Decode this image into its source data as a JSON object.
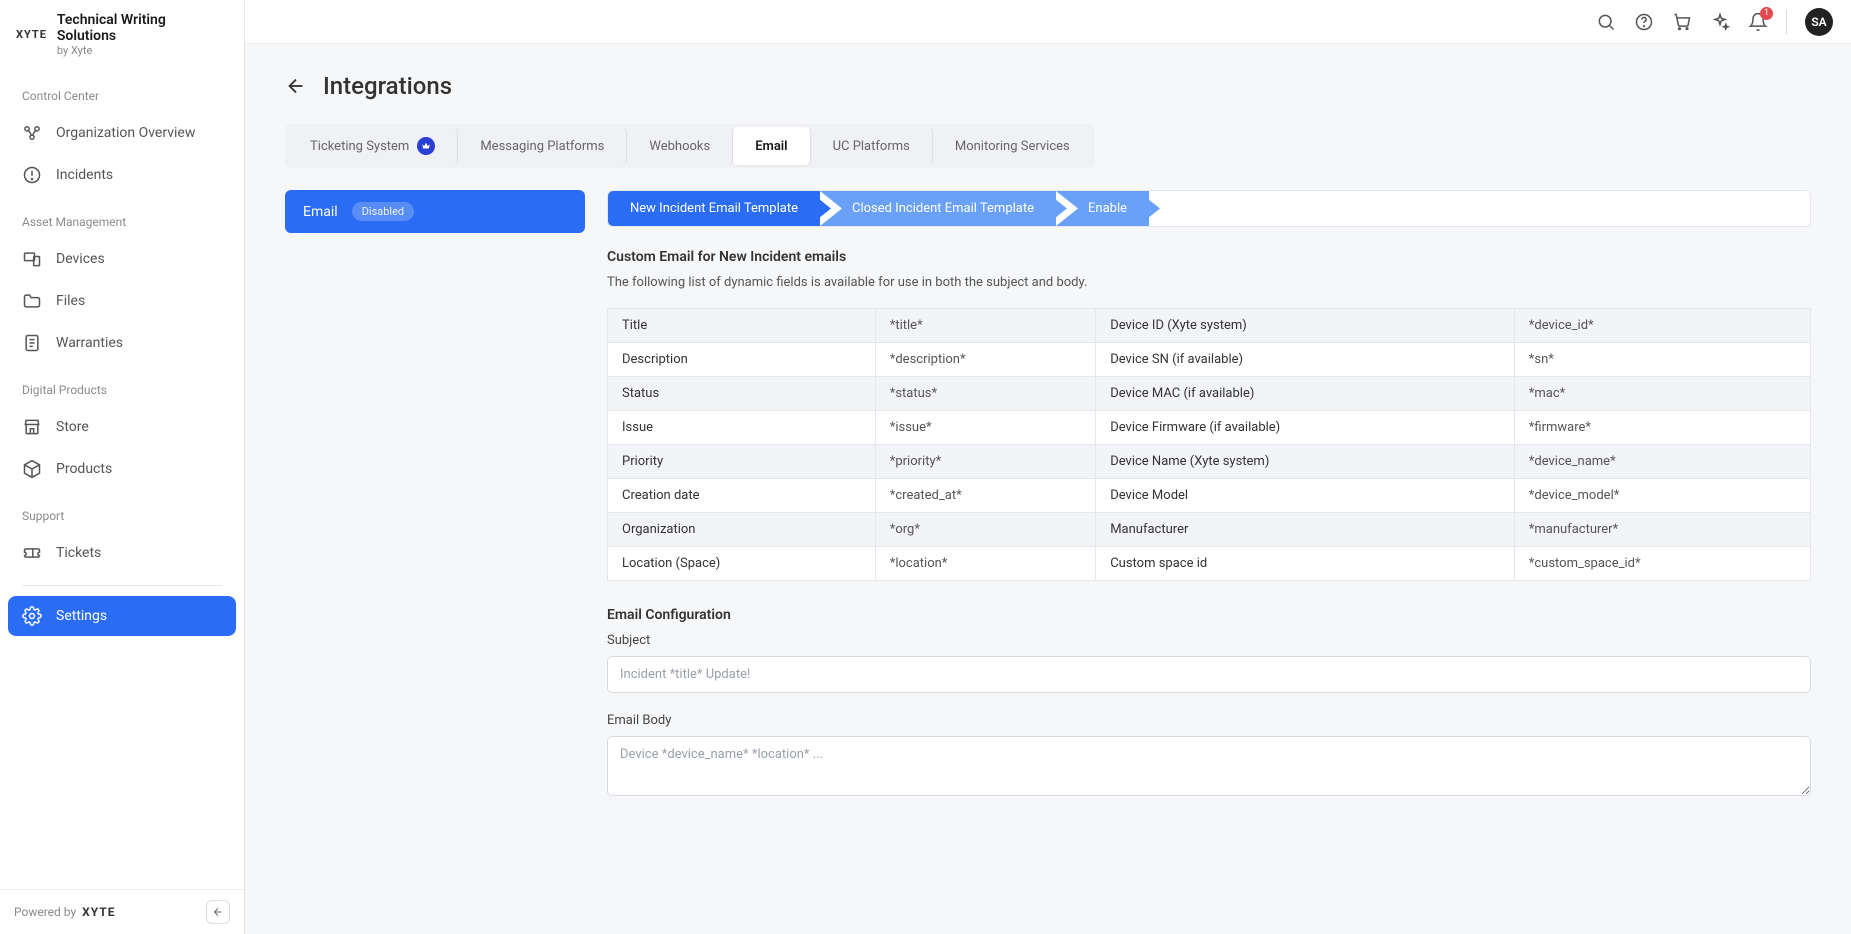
{
  "brand": {
    "logo": "XYTE",
    "title": "Technical Writing Solutions",
    "subtitle": "by Xyte"
  },
  "sidebar": {
    "sections": [
      {
        "heading": "Control Center",
        "items": [
          {
            "label": "Organization Overview",
            "icon": "org"
          },
          {
            "label": "Incidents",
            "icon": "alert"
          }
        ]
      },
      {
        "heading": "Asset Management",
        "items": [
          {
            "label": "Devices",
            "icon": "devices"
          },
          {
            "label": "Files",
            "icon": "folder"
          },
          {
            "label": "Warranties",
            "icon": "doc"
          }
        ]
      },
      {
        "heading": "Digital Products",
        "items": [
          {
            "label": "Store",
            "icon": "store"
          },
          {
            "label": "Products",
            "icon": "cube"
          }
        ]
      },
      {
        "heading": "Support",
        "items": [
          {
            "label": "Tickets",
            "icon": "ticket"
          }
        ]
      }
    ],
    "settings_label": "Settings",
    "powered_by": "Powered by",
    "powered_logo": "XYTE"
  },
  "topbar": {
    "notification_count": "1",
    "avatar_initials": "SA"
  },
  "page": {
    "title": "Integrations"
  },
  "tabs": [
    {
      "label": "Ticketing System",
      "premium": true
    },
    {
      "label": "Messaging Platforms"
    },
    {
      "label": "Webhooks"
    },
    {
      "label": "Email",
      "active": true
    },
    {
      "label": "UC Platforms"
    },
    {
      "label": "Monitoring Services"
    }
  ],
  "sub_tab": {
    "label": "Email",
    "status": "Disabled"
  },
  "steps": [
    {
      "label": "New Incident Email Template"
    },
    {
      "label": "Closed Incident Email Template"
    },
    {
      "label": "Enable"
    }
  ],
  "section": {
    "title": "Custom Email for New Incident emails",
    "desc": "The following list of dynamic fields is available for use in both the subject and body."
  },
  "fields_table": [
    [
      "Title",
      "*title*",
      "Device ID (Xyte system)",
      "*device_id*"
    ],
    [
      "Description",
      "*description*",
      "Device SN (if available)",
      "*sn*"
    ],
    [
      "Status",
      "*status*",
      "Device MAC (if available)",
      "*mac*"
    ],
    [
      "Issue",
      "*issue*",
      "Device Firmware (if available)",
      "*firmware*"
    ],
    [
      "Priority",
      "*priority*",
      "Device Name (Xyte system)",
      "*device_name*"
    ],
    [
      "Creation date",
      "*created_at*",
      "Device Model",
      "*device_model*"
    ],
    [
      "Organization",
      "*org*",
      "Manufacturer",
      "*manufacturer*"
    ],
    [
      "Location (Space)",
      "*location*",
      "Custom space id",
      "*custom_space_id*"
    ]
  ],
  "email_config": {
    "heading": "Email Configuration",
    "subject_label": "Subject",
    "subject_placeholder": "Incident *title* Update!",
    "body_label": "Email Body",
    "body_placeholder": "Device *device_name* *location* ..."
  }
}
